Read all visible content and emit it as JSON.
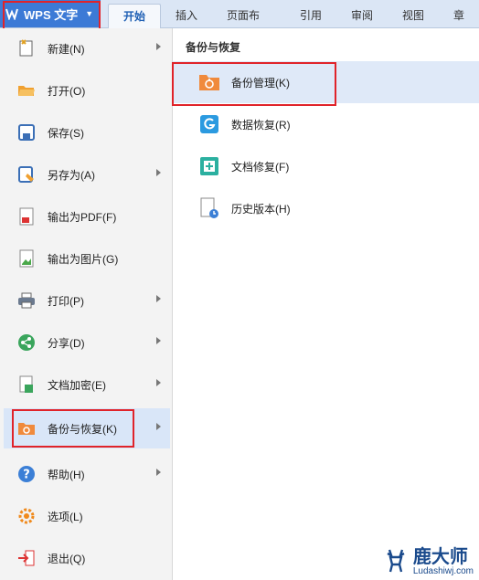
{
  "app": {
    "button_label": "WPS 文字",
    "accent": "#3c7ad6",
    "highlight": "#e0232a"
  },
  "tabs": [
    {
      "label": "开始",
      "active": true
    },
    {
      "label": "插入"
    },
    {
      "label": "页面布局"
    },
    {
      "label": "引用"
    },
    {
      "label": "审阅"
    },
    {
      "label": "视图"
    },
    {
      "label": "章"
    }
  ],
  "menu": [
    {
      "label": "新建(N)",
      "icon": "new-doc-icon",
      "submenu": true
    },
    {
      "label": "打开(O)",
      "icon": "open-folder-icon",
      "submenu": false
    },
    {
      "label": "保存(S)",
      "icon": "save-icon",
      "submenu": false
    },
    {
      "label": "另存为(A)",
      "icon": "save-as-icon",
      "submenu": true
    },
    {
      "label": "输出为PDF(F)",
      "icon": "pdf-icon",
      "submenu": false
    },
    {
      "label": "输出为图片(G)",
      "icon": "export-image-icon",
      "submenu": false
    },
    {
      "label": "打印(P)",
      "icon": "print-icon",
      "submenu": true
    },
    {
      "label": "分享(D)",
      "icon": "share-icon",
      "submenu": true
    },
    {
      "label": "文档加密(E)",
      "icon": "encrypt-icon",
      "submenu": true
    },
    {
      "label": "备份与恢复(K)",
      "icon": "backup-restore-icon",
      "submenu": true,
      "selected": true
    },
    {
      "label": "帮助(H)",
      "icon": "help-icon",
      "submenu": true
    },
    {
      "label": "选项(L)",
      "icon": "options-gear-icon",
      "submenu": false
    },
    {
      "label": "退出(Q)",
      "icon": "exit-icon",
      "submenu": false
    }
  ],
  "panel": {
    "title": "备份与恢复",
    "items": [
      {
        "label": "备份管理(K)",
        "icon": "backup-folder-icon",
        "selected": true
      },
      {
        "label": "数据恢复(R)",
        "icon": "data-recovery-icon"
      },
      {
        "label": "文档修复(F)",
        "icon": "document-repair-icon"
      },
      {
        "label": "历史版本(H)",
        "icon": "history-version-icon"
      }
    ]
  },
  "watermark": {
    "cn": "鹿大师",
    "en": "Ludashiwj.com"
  }
}
